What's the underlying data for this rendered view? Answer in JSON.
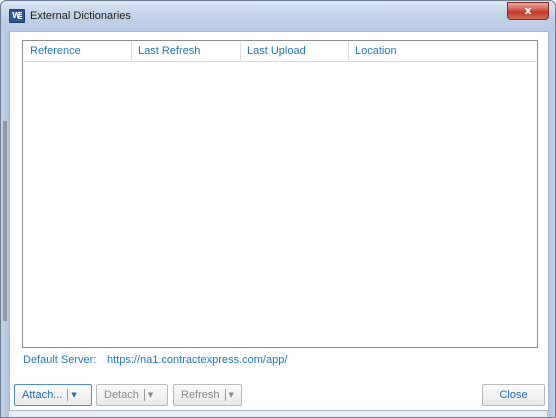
{
  "window": {
    "title": "External Dictionaries",
    "app_icon_letter": "W",
    "close_glyph": "x"
  },
  "table": {
    "columns": [
      "Reference",
      "Last Refresh",
      "Last Upload",
      "Location"
    ],
    "rows": []
  },
  "server": {
    "label": "Default Server:",
    "url": "https://na1.contractexpress.com/app/"
  },
  "buttons": {
    "attach": "Attach...",
    "detach": "Detach",
    "refresh": "Refresh",
    "close": "Close",
    "dropdown_glyph": "▼"
  },
  "colors": {
    "accent": "#1f7ab4",
    "titlebar": "#c2d3e8",
    "close_button": "#c0392b"
  }
}
